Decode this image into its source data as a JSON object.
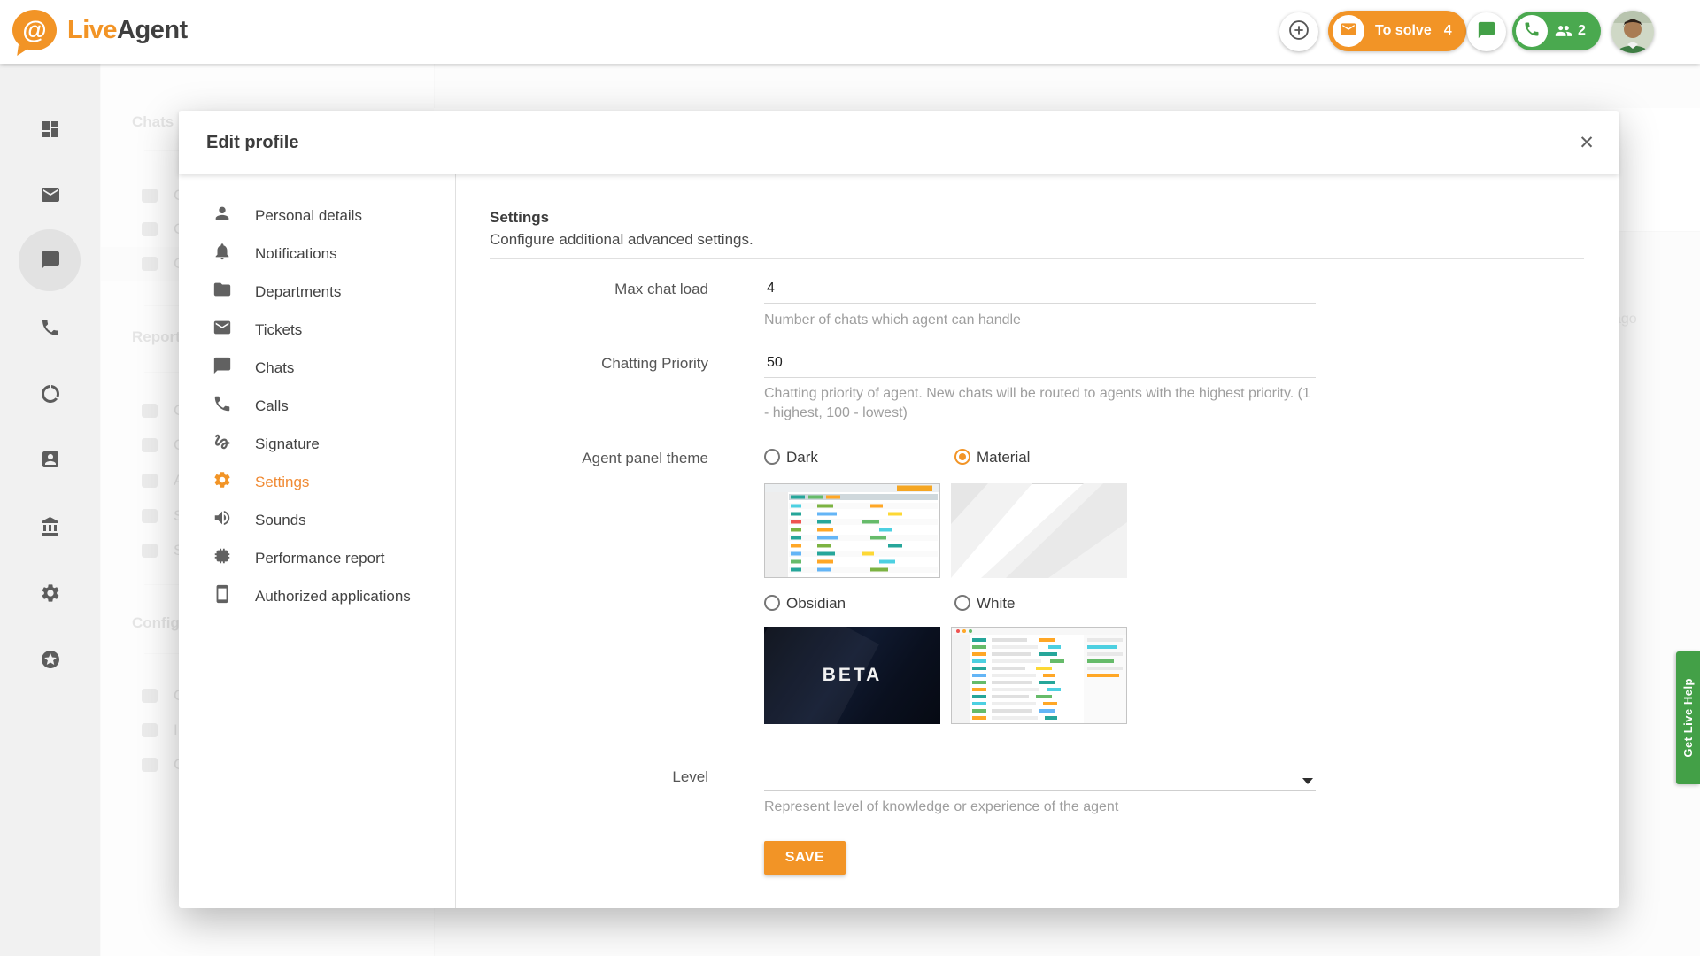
{
  "topbar": {
    "logo": {
      "at": "@",
      "live": "Live",
      "agent": "Agent"
    },
    "to_solve": {
      "label": "To solve",
      "count": "4"
    },
    "calls": {
      "count": "2"
    }
  },
  "sidebar": {
    "icons": [
      "dashboard",
      "mail",
      "chats",
      "calls",
      "reports",
      "contacts",
      "company",
      "settings",
      "starred"
    ]
  },
  "background": {
    "left_nav": {
      "sections": [
        {
          "header": "Chats",
          "items": [
            {
              "label": "C"
            },
            {
              "label": "C"
            },
            {
              "label": "C"
            }
          ]
        },
        {
          "header": "Reports",
          "items": [
            {
              "label": "C"
            },
            {
              "label": "C"
            },
            {
              "label": "A"
            },
            {
              "label": "S"
            },
            {
              "label": "S"
            }
          ]
        },
        {
          "header": "Configu",
          "items": [
            {
              "label": "C"
            },
            {
              "label": "I"
            },
            {
              "label": "C"
            }
          ]
        }
      ]
    },
    "main_fragment": "ago"
  },
  "modal": {
    "title": "Edit profile",
    "close_glyph": "✕",
    "nav": [
      {
        "label": "Personal details",
        "active": false
      },
      {
        "label": "Notifications",
        "active": false
      },
      {
        "label": "Departments",
        "active": false
      },
      {
        "label": "Tickets",
        "active": false
      },
      {
        "label": "Chats",
        "active": false
      },
      {
        "label": "Calls",
        "active": false
      },
      {
        "label": "Signature",
        "active": false
      },
      {
        "label": "Settings",
        "active": true
      },
      {
        "label": "Sounds",
        "active": false
      },
      {
        "label": "Performance report",
        "active": false
      },
      {
        "label": "Authorized applications",
        "active": false
      }
    ],
    "content": {
      "heading": "Settings",
      "subheading": "Configure additional advanced settings.",
      "max_chat_load": {
        "label": "Max chat load",
        "value": "4",
        "help": "Number of chats which agent can handle"
      },
      "chatting_priority": {
        "label": "Chatting Priority",
        "value": "50",
        "help": "Chatting priority of agent. New chats will be routed to agents with the highest priority. (1 - highest, 100 - lowest)"
      },
      "theme": {
        "label": "Agent panel theme",
        "options": [
          {
            "label": "Dark",
            "selected": false
          },
          {
            "label": "Material",
            "selected": true
          },
          {
            "label": "Obsidian",
            "selected": false
          },
          {
            "label": "White",
            "selected": false
          }
        ],
        "obsidian_badge": "BETA"
      },
      "level": {
        "label": "Level",
        "value": "",
        "help": "Represent level of knowledge or experience of the agent"
      },
      "save_label": "SAVE"
    }
  },
  "live_help": {
    "label": "Get Live Help"
  },
  "colors": {
    "accent_orange": "#F29426",
    "pill_green": "#4AA94F",
    "help_green": "#43A047"
  }
}
